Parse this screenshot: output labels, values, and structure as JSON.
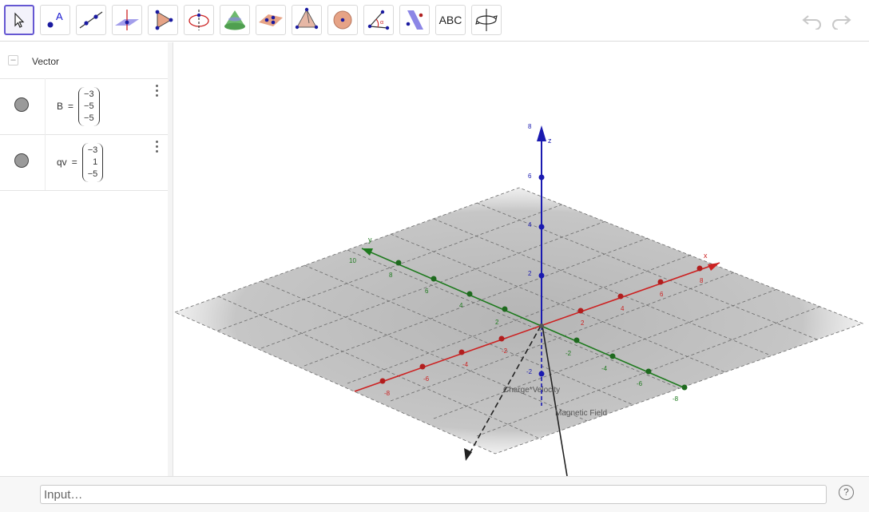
{
  "toolbar": {
    "tools": [
      {
        "name": "move-tool",
        "icon": "arrow-pointer-icon"
      },
      {
        "name": "point-tool",
        "icon": "point-icon",
        "glyph": "A"
      },
      {
        "name": "line-tool",
        "icon": "line-icon"
      },
      {
        "name": "perpendicular-line-tool",
        "icon": "perpendicular-plane-icon"
      },
      {
        "name": "polygon-tool",
        "icon": "polygon-icon"
      },
      {
        "name": "circle-axis-tool",
        "icon": "circle-axis-icon"
      },
      {
        "name": "cone-tool",
        "icon": "cone-icon"
      },
      {
        "name": "plane-through-points-tool",
        "icon": "plane-points-icon"
      },
      {
        "name": "pyramid-tool",
        "icon": "pyramid-icon"
      },
      {
        "name": "sphere-tool",
        "icon": "sphere-icon"
      },
      {
        "name": "angle-tool",
        "icon": "angle-icon"
      },
      {
        "name": "reflect-tool",
        "icon": "reflect-plane-icon"
      },
      {
        "name": "text-tool",
        "icon": "text-icon",
        "label": "ABC"
      },
      {
        "name": "rotate-view-tool",
        "icon": "rotate-view-icon"
      }
    ],
    "undo": "undo-icon",
    "redo": "redo-icon"
  },
  "algebra": {
    "group_label": "Vector",
    "collapse_symbol": "–",
    "rows": [
      {
        "name": "B",
        "eq": "=",
        "values": [
          "−3",
          "−5",
          "−5"
        ]
      },
      {
        "name": "qv",
        "eq": "=",
        "values": [
          "−3",
          "1",
          "−5"
        ]
      }
    ]
  },
  "graphics": {
    "axis_labels": {
      "x": "x",
      "y": "y",
      "z": "z"
    },
    "x_ticks": [
      "-8",
      "-6",
      "-4",
      "-2",
      "2",
      "4",
      "6",
      "8"
    ],
    "y_ticks": [
      "10",
      "8",
      "6",
      "4",
      "2",
      "-2",
      "-4",
      "-6",
      "-8"
    ],
    "z_ticks": [
      "8",
      "6",
      "4",
      "2",
      "-2"
    ],
    "vector_labels": {
      "qv": "Charge*Velocity",
      "B": "Magnetic Field"
    },
    "colors": {
      "x_axis": "#cc2222",
      "y_axis": "#1e7a1e",
      "z_axis": "#1a1ab0",
      "accent": "#6557d2"
    }
  },
  "input_bar": {
    "placeholder": "Input…",
    "help": "?"
  }
}
